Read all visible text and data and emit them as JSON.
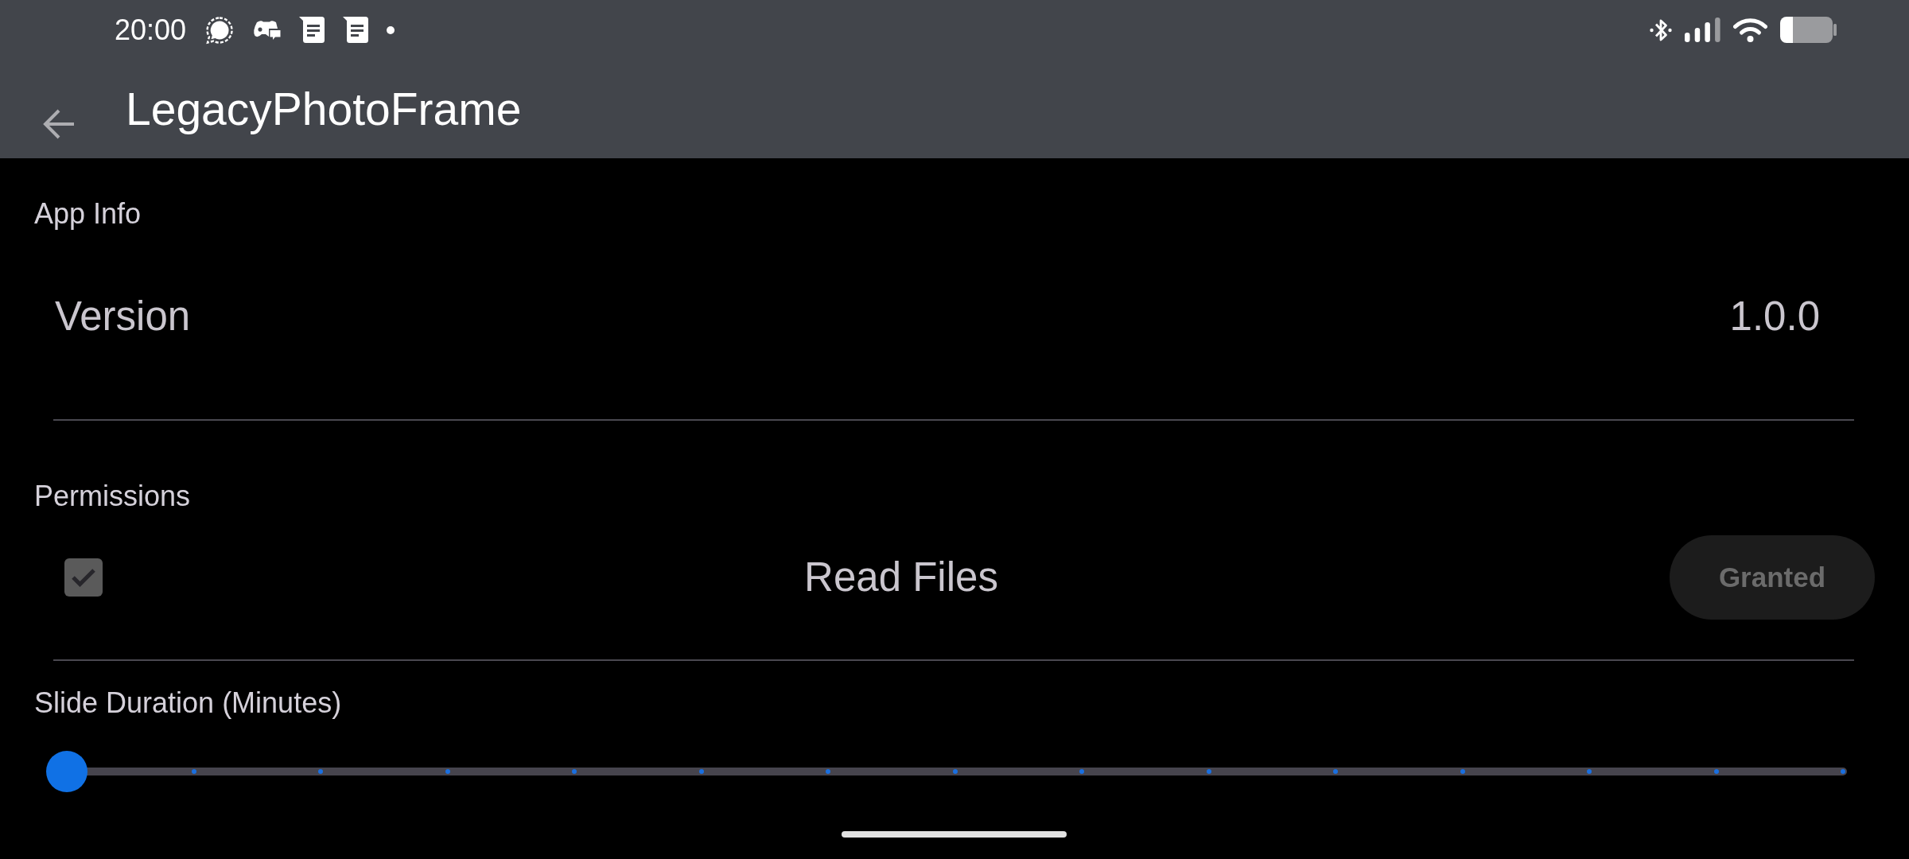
{
  "status_bar": {
    "time": "20:00"
  },
  "app_bar": {
    "title": "LegacyPhotoFrame"
  },
  "sections": [
    {
      "kind": "info",
      "heading": "App Info",
      "rows": [
        {
          "label": "Version",
          "value": "1.0.0"
        }
      ]
    },
    {
      "kind": "permissions",
      "heading": "Permissions",
      "rows": [
        {
          "label": "Read Files",
          "checked": true,
          "button": "Granted",
          "disabled": true
        }
      ]
    },
    {
      "kind": "slider",
      "heading": "Slide Duration (Minutes)",
      "level": 0
    }
  ]
}
